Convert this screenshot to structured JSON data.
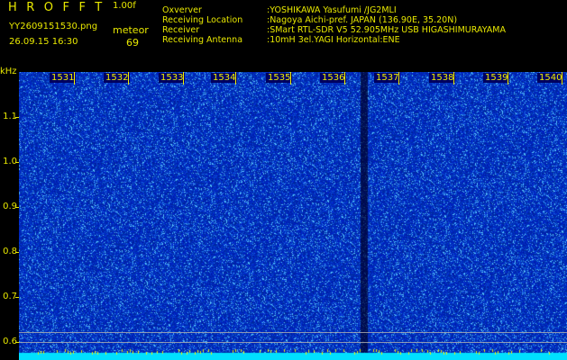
{
  "header": {
    "title": "HROFFT",
    "version": "1.00f",
    "filename": "YY2609151530.png",
    "timestamp": "26.09.15 16:30",
    "meteor_label": "meteor",
    "meteor_count": "69"
  },
  "info": [
    {
      "key": "Oxverver",
      "value": ":YOSHIKAWA Yasufumi /JG2MLI"
    },
    {
      "key": "Receiving Location",
      "value": ":Nagoya Aichi-pref. JAPAN (136.90E, 35.20N)"
    },
    {
      "key": "Receiver",
      "value": ":SMart RTL-SDR V5 52.905MHz USB HIGASHIMURAYAMA"
    },
    {
      "key": "Receiving Antenna",
      "value": ":10mH 3el.YAGI Horizontal:ENE"
    }
  ],
  "axis": {
    "unit": "kHz",
    "y_labels": [
      "1.1",
      "1.0",
      "0.9",
      "0.8",
      "0.7",
      "0.6"
    ],
    "x_labels": [
      "1531",
      "1532",
      "1533",
      "1534",
      "1535",
      "1536",
      "1537",
      "1538",
      "1539",
      "1540"
    ]
  },
  "colors": {
    "background": "#000000",
    "text": "#e8e800",
    "noise_base": "#0018c0",
    "noise_speckle": "#40c0ff",
    "baseline": "#00e0ff"
  }
}
